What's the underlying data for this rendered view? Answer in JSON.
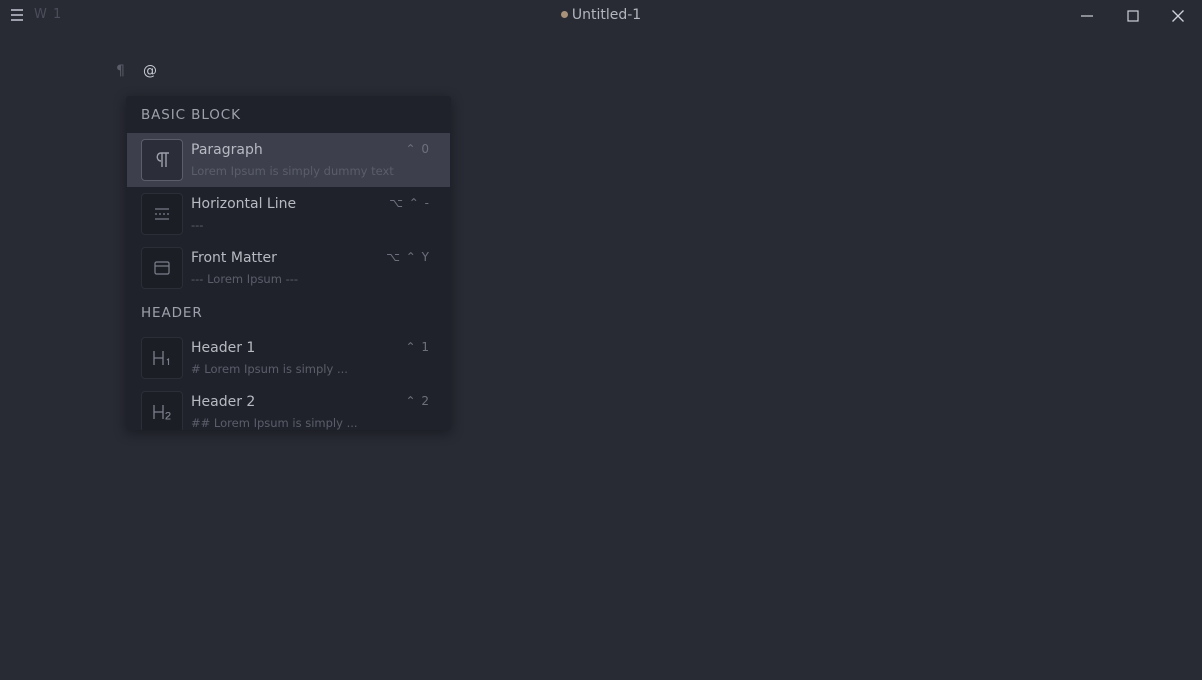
{
  "titlebar": {
    "word_count": "W 1",
    "title": "Untitled-1",
    "unsaved_dot_color": "#a8937a"
  },
  "editor": {
    "paragraph_marker": "¶",
    "typed_text": "@"
  },
  "quick_insert": {
    "groups": [
      {
        "title": "BASIC BLOCK",
        "items": [
          {
            "label": "Paragraph",
            "desc": "Lorem Ipsum is simply dummy text",
            "shortcut": "⌃ 0",
            "icon": "paragraph-icon",
            "active": true
          },
          {
            "label": "Horizontal Line",
            "desc": "---",
            "shortcut": "⌥ ⌃ -",
            "icon": "horizontal-line-icon"
          },
          {
            "label": "Front Matter",
            "desc": "--- Lorem Ipsum ---",
            "shortcut": "⌥ ⌃ Y",
            "icon": "front-matter-icon"
          }
        ]
      },
      {
        "title": "HEADER",
        "items": [
          {
            "label": "Header 1",
            "desc": "# Lorem Ipsum is simply ...",
            "shortcut": "⌃ 1",
            "icon": "header1-icon"
          },
          {
            "label": "Header 2",
            "desc": "## Lorem Ipsum is simply ...",
            "shortcut": "⌃ 2",
            "icon": "header2-icon"
          }
        ]
      }
    ]
  }
}
